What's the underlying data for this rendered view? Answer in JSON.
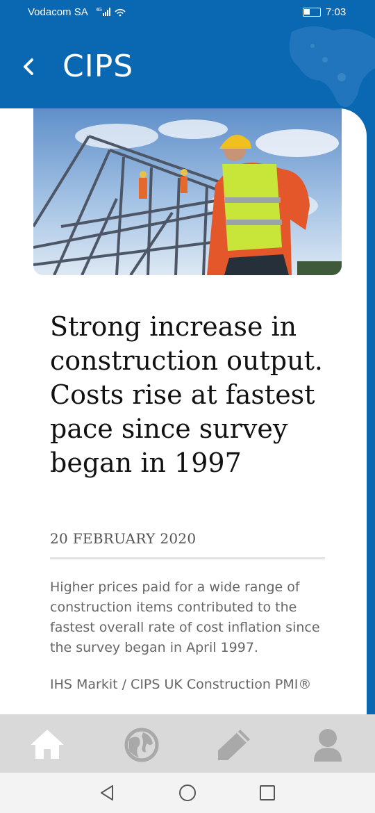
{
  "status_bar": {
    "carrier": "Vodacom SA",
    "network": "4G",
    "time": "7:03"
  },
  "header": {
    "title": "CIPS",
    "back_icon": "chevron-left-icon",
    "background_color": "#0a67b2"
  },
  "article": {
    "headline": "Strong increase in construction output. Costs rise at fastest pace since survey began in 1997",
    "date": "20 FEBRUARY 2020",
    "summary": "Higher prices paid for a wide range of construction items contributed to the fastest overall rate of cost inflation since the survey began in April 1997.",
    "source": "IHS Markit / CIPS UK Construction PMI®"
  },
  "bottom_nav": {
    "items": [
      {
        "icon": "home-icon",
        "active": true
      },
      {
        "icon": "globe-icon",
        "active": false
      },
      {
        "icon": "pencil-icon",
        "active": false
      },
      {
        "icon": "user-icon",
        "active": false
      }
    ]
  },
  "system_nav": {
    "icons": [
      "back-triangle-icon",
      "home-circle-icon",
      "recents-square-icon"
    ]
  }
}
